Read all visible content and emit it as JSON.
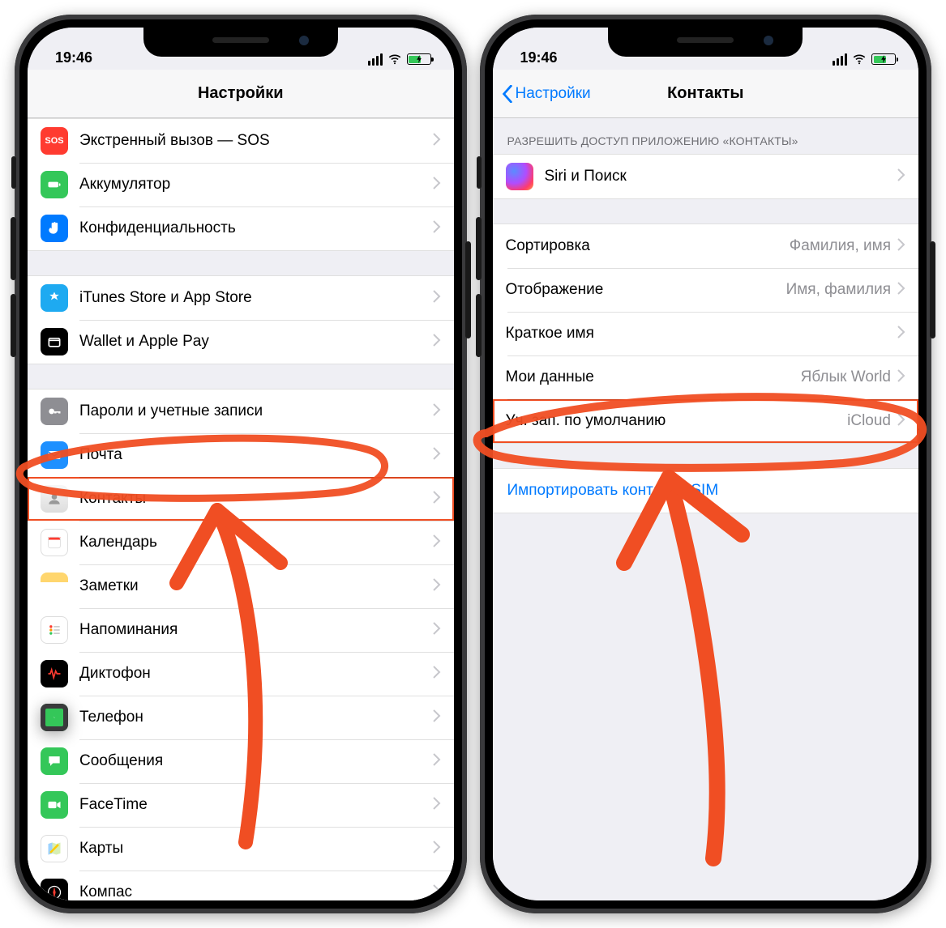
{
  "status": {
    "time": "19:46"
  },
  "left": {
    "title": "Настройки",
    "groups": [
      {
        "items": [
          {
            "icon": "sos",
            "label": "Экстренный вызов — SOS"
          },
          {
            "icon": "batt-ic",
            "label": "Аккумулятор"
          },
          {
            "icon": "hand",
            "label": "Конфиденциальность"
          }
        ]
      },
      {
        "items": [
          {
            "icon": "store",
            "label": "iTunes Store и App Store"
          },
          {
            "icon": "wallet",
            "label": "Wallet и Apple Pay"
          }
        ]
      },
      {
        "items": [
          {
            "icon": "keys",
            "label": "Пароли и учетные записи"
          },
          {
            "icon": "mail",
            "label": "Почта"
          },
          {
            "icon": "contacts",
            "label": "Контакты",
            "highlight": true
          },
          {
            "icon": "calendar",
            "label": "Календарь"
          },
          {
            "icon": "notes",
            "label": "Заметки"
          },
          {
            "icon": "remind",
            "label": "Напоминания"
          },
          {
            "icon": "voice",
            "label": "Диктофон"
          },
          {
            "icon": "phone",
            "label": "Телефон"
          },
          {
            "icon": "msg",
            "label": "Сообщения"
          },
          {
            "icon": "ft",
            "label": "FaceTime"
          },
          {
            "icon": "maps",
            "label": "Карты"
          },
          {
            "icon": "compass",
            "label": "Компас"
          }
        ]
      }
    ]
  },
  "right": {
    "back": "Настройки",
    "title": "Контакты",
    "section_header": "РАЗРЕШИТЬ ДОСТУП ПРИЛОЖЕНИЮ «КОНТАКТЫ»",
    "siri_row": "Siri и Поиск",
    "rows": [
      {
        "label": "Сортировка",
        "value": "Фамилия, имя"
      },
      {
        "label": "Отображение",
        "value": "Имя, фамилия"
      },
      {
        "label": "Краткое имя",
        "value": ""
      },
      {
        "label": "Мои данные",
        "value": "Яблык World"
      },
      {
        "label": "Уч. зап. по умолчанию",
        "value": "iCloud",
        "highlight": true
      }
    ],
    "import_link": "Импортировать контакты SIM"
  }
}
